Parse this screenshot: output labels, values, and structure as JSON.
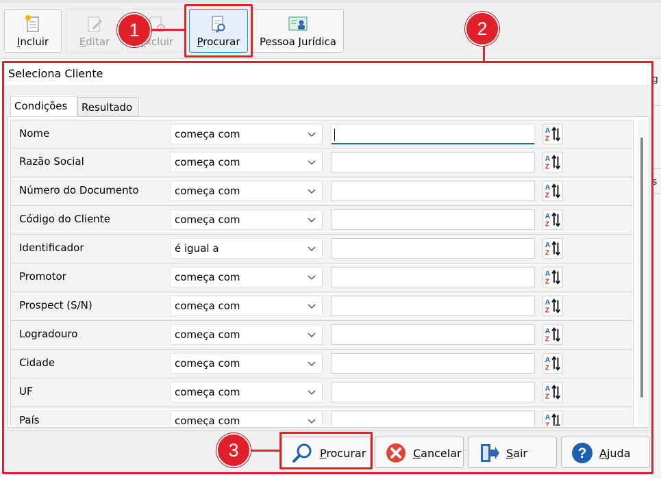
{
  "toolbar": {
    "buttons": [
      {
        "label": "Incluir",
        "underline": "I",
        "rest": "ncluir",
        "enabled": true
      },
      {
        "label": "Editar",
        "underline": "E",
        "rest": "ditar",
        "enabled": false
      },
      {
        "label": "Excluir",
        "underline": "E",
        "rest": "xcluir",
        "enabled": false
      },
      {
        "label": "Procurar",
        "underline": "P",
        "rest": "rocurar",
        "enabled": true
      },
      {
        "label": "Pessoa Jurídica",
        "underline": "",
        "rest": "Pessoa Jurídica",
        "enabled": true
      }
    ]
  },
  "callouts": [
    "1",
    "2",
    "3"
  ],
  "dialog": {
    "title": "Seleciona Cliente",
    "tabs": [
      "Condições",
      "Resultado"
    ],
    "rows": [
      {
        "field": "Nome",
        "operator": "começa com",
        "value": ""
      },
      {
        "field": "Razão Social",
        "operator": "começa com",
        "value": ""
      },
      {
        "field": "Número do Documento",
        "operator": "começa com",
        "value": ""
      },
      {
        "field": "Código do Cliente",
        "operator": "começa com",
        "value": ""
      },
      {
        "field": "Identificador",
        "operator": "é igual a",
        "value": ""
      },
      {
        "field": "Promotor",
        "operator": "começa com",
        "value": ""
      },
      {
        "field": "Prospect (S/N)",
        "operator": "começa com",
        "value": ""
      },
      {
        "field": "Logradouro",
        "operator": "começa com",
        "value": ""
      },
      {
        "field": "Cidade",
        "operator": "começa com",
        "value": ""
      },
      {
        "field": "UF",
        "operator": "começa com",
        "value": ""
      },
      {
        "field": "País",
        "operator": "começa com",
        "value": ""
      }
    ],
    "buttons": {
      "procurar": {
        "u": "P",
        "rest": "rocurar"
      },
      "cancelar": {
        "u": "C",
        "rest": "ancelar"
      },
      "sair": {
        "u": "S",
        "rest": "air"
      },
      "ajuda": {
        "u": "A",
        "rest": "juda"
      }
    }
  },
  "background": {
    "frag1": "g",
    "frag2": "s"
  },
  "colors": {
    "highlight": "#e2202a",
    "accent": "#0f6cbd"
  }
}
